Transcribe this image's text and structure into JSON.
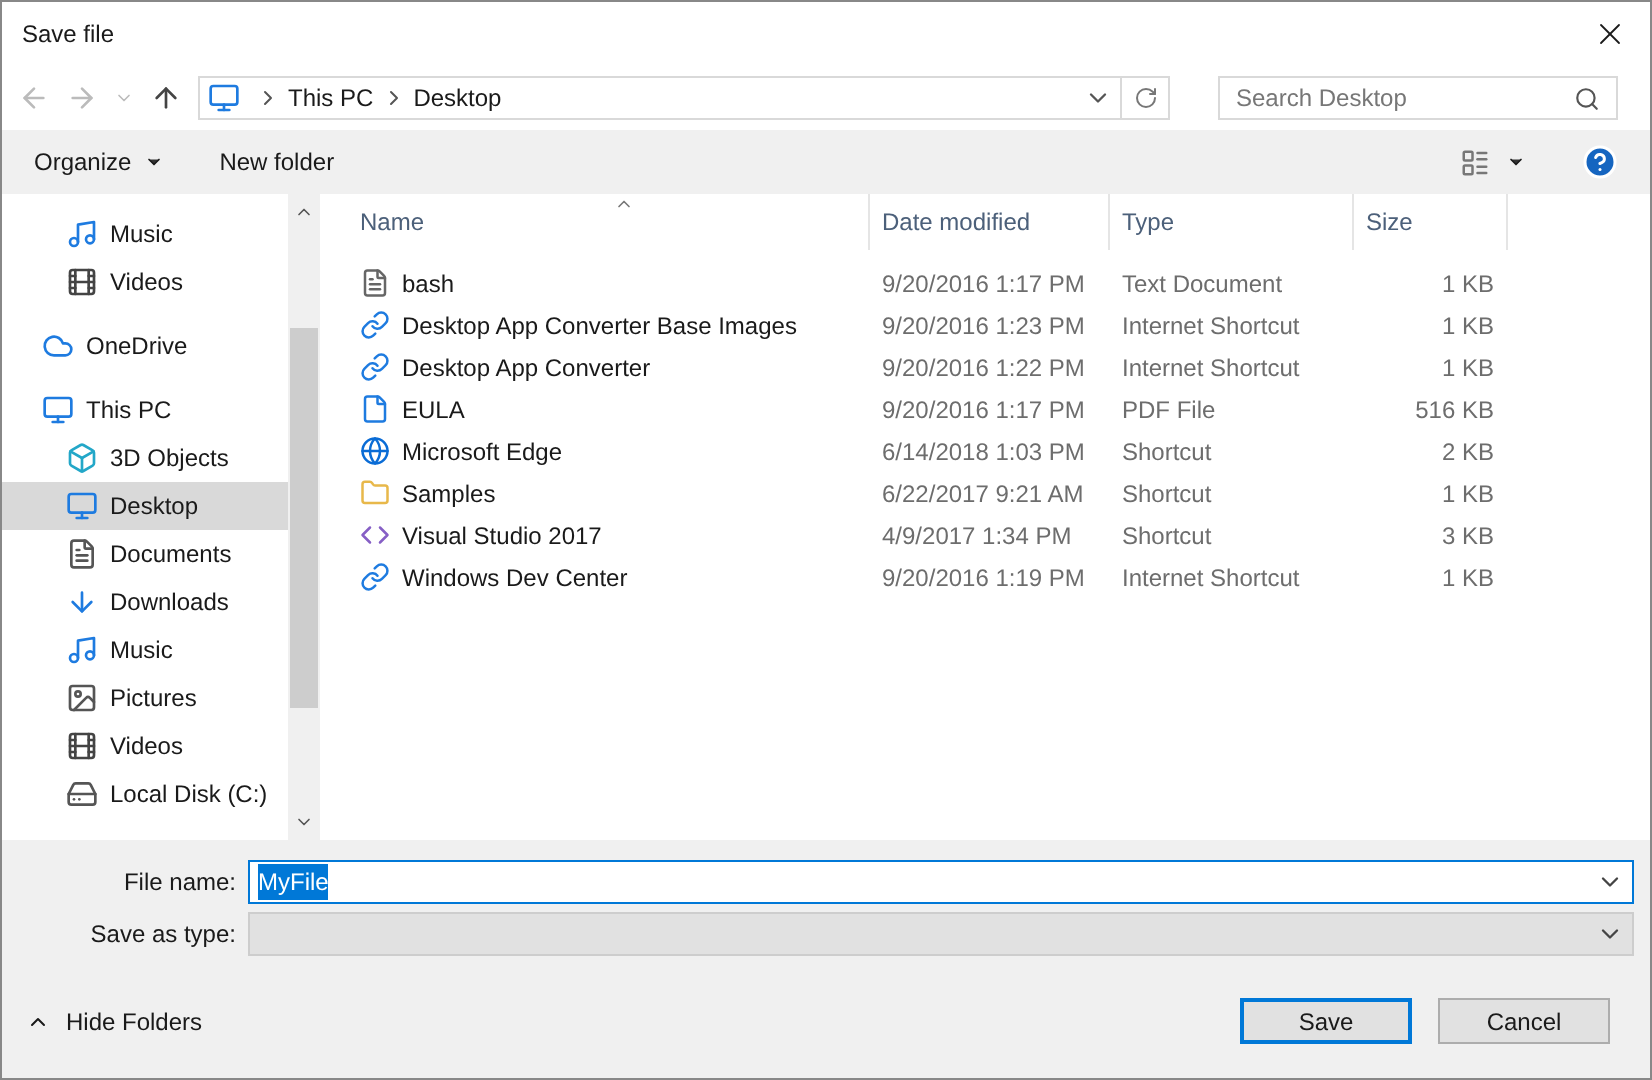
{
  "window": {
    "title": "Save file"
  },
  "address": {
    "path": [
      "This PC",
      "Desktop"
    ]
  },
  "search": {
    "placeholder": "Search Desktop"
  },
  "toolbar": {
    "organize": "Organize",
    "new_folder": "New folder"
  },
  "sidebar": {
    "items": [
      {
        "label": "Music",
        "kind": "music",
        "selected": false
      },
      {
        "label": "Videos",
        "kind": "video",
        "selected": false
      },
      {
        "label": "OneDrive",
        "kind": "cloud",
        "selected": false
      },
      {
        "label": "This PC",
        "kind": "pc",
        "selected": false,
        "children": [
          {
            "label": "3D Objects",
            "kind": "cube",
            "selected": false
          },
          {
            "label": "Desktop",
            "kind": "desktop",
            "selected": true
          },
          {
            "label": "Documents",
            "kind": "doc",
            "selected": false
          },
          {
            "label": "Downloads",
            "kind": "download",
            "selected": false
          },
          {
            "label": "Music",
            "kind": "music",
            "selected": false
          },
          {
            "label": "Pictures",
            "kind": "picture",
            "selected": false
          },
          {
            "label": "Videos",
            "kind": "video",
            "selected": false
          },
          {
            "label": "Local Disk (C:)",
            "kind": "disk",
            "selected": false
          }
        ]
      }
    ]
  },
  "table": {
    "columns": [
      {
        "label": "Name",
        "sorted": true
      },
      {
        "label": "Date modified",
        "sorted": false
      },
      {
        "label": "Type",
        "sorted": false
      },
      {
        "label": "Size",
        "sorted": false
      }
    ],
    "rows": [
      {
        "kind": "text",
        "name": "bash",
        "date": "9/20/2016 1:17 PM",
        "type": "Text Document",
        "size": "1 KB",
        "selected": false
      },
      {
        "kind": "link",
        "name": "Desktop App Converter Base Images",
        "date": "9/20/2016 1:23 PM",
        "type": "Internet Shortcut",
        "size": "1 KB",
        "selected": false
      },
      {
        "kind": "link",
        "name": "Desktop App Converter",
        "date": "9/20/2016 1:22 PM",
        "type": "Internet Shortcut",
        "size": "1 KB",
        "selected": false
      },
      {
        "kind": "pdf",
        "name": "EULA",
        "date": "9/20/2016 1:17 PM",
        "type": "PDF File",
        "size": "516 KB",
        "selected": false
      },
      {
        "kind": "edge",
        "name": "Microsoft Edge",
        "date": "6/14/2018 1:03 PM",
        "type": "Shortcut",
        "size": "2 KB",
        "selected": false
      },
      {
        "kind": "folder",
        "name": "Samples",
        "date": "6/22/2017 9:21 AM",
        "type": "Shortcut",
        "size": "1 KB",
        "selected": false
      },
      {
        "kind": "vs",
        "name": "Visual Studio 2017",
        "date": "4/9/2017 1:34 PM",
        "type": "Shortcut",
        "size": "3 KB",
        "selected": false
      },
      {
        "kind": "link",
        "name": "Windows Dev Center",
        "date": "9/20/2016 1:19 PM",
        "type": "Internet Shortcut",
        "size": "1 KB",
        "selected": false
      }
    ]
  },
  "form": {
    "file_name_label": "File name:",
    "file_name": "MyFile",
    "file_name_text_selected": true,
    "type_label": "Save as type:"
  },
  "footer": {
    "hide_folders": "Hide Folders",
    "save": "Save",
    "cancel": "Cancel"
  }
}
